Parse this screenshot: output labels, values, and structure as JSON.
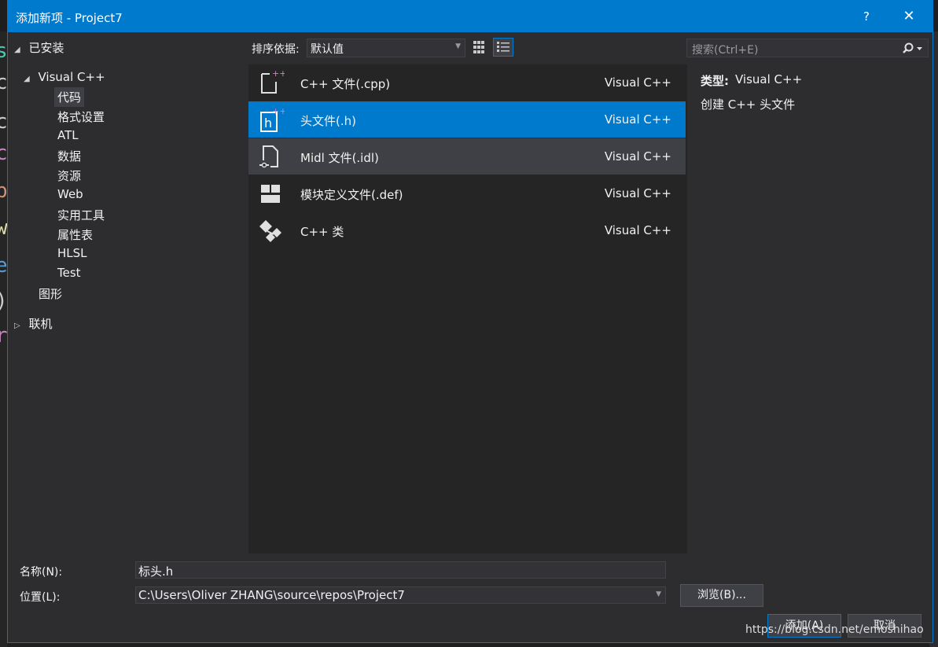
{
  "dialog": {
    "title": "添加新项 - Project7",
    "help": "?",
    "close": "✕"
  },
  "tree": {
    "installed": "已安装",
    "visual_cpp": "Visual C++",
    "children": [
      "代码",
      "格式设置",
      "ATL",
      "数据",
      "资源",
      "Web",
      "实用工具",
      "属性表",
      "HLSL",
      "Test"
    ],
    "graphics": "图形",
    "online": "联机"
  },
  "toolbar": {
    "sort_label": "排序依据:",
    "sort_value": "默认值",
    "search_placeholder": "搜索(Ctrl+E)"
  },
  "items": [
    {
      "name": "C++ 文件(.cpp)",
      "lang": "Visual C++",
      "icon": "cpp-file-icon"
    },
    {
      "name": "头文件(.h)",
      "lang": "Visual C++",
      "icon": "header-file-icon"
    },
    {
      "name": "Midl 文件(.idl)",
      "lang": "Visual C++",
      "icon": "midl-file-icon"
    },
    {
      "name": "模块定义文件(.def)",
      "lang": "Visual C++",
      "icon": "def-file-icon"
    },
    {
      "name": "C++ 类",
      "lang": "Visual C++",
      "icon": "cpp-class-icon"
    }
  ],
  "detail": {
    "type_label": "类型:",
    "type_value": "Visual C++",
    "description": "创建 C++ 头文件"
  },
  "bottom": {
    "name_label": "名称(N):",
    "name_value": "标头.h",
    "location_label": "位置(L):",
    "location_value": "C:\\Users\\Oliver ZHANG\\source\\repos\\Project7",
    "browse": "浏览(B)...",
    "add": "添加(A)",
    "cancel": "取消"
  },
  "watermark": "https://blog.csdn.net/emoshihao",
  "colors": {
    "accent": "#007acc",
    "dialog_bg": "#2d2d30",
    "list_bg": "#252526"
  }
}
